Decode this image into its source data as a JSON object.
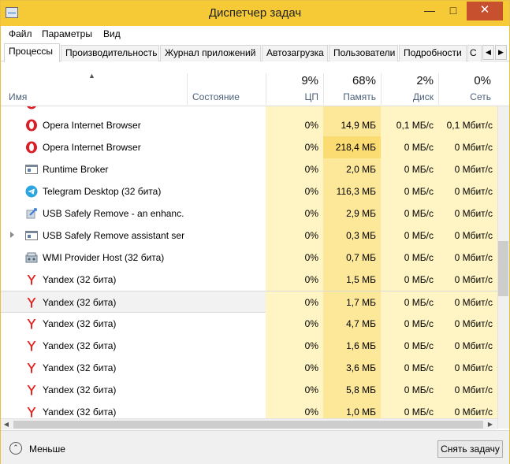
{
  "window": {
    "title": "Диспетчер задач"
  },
  "menu": [
    "Файл",
    "Параметры",
    "Вид"
  ],
  "tabs": [
    "Процессы",
    "Производительность",
    "Журнал приложений",
    "Автозагрузка",
    "Пользователи",
    "Подробности",
    "С"
  ],
  "columns": {
    "name": "Имя",
    "status": "Состояние",
    "cpu": {
      "pct": "9%",
      "label": "ЦП"
    },
    "memory": {
      "pct": "68%",
      "label": "Память"
    },
    "disk": {
      "pct": "2%",
      "label": "Диск"
    },
    "network": {
      "pct": "0%",
      "label": "Сеть"
    }
  },
  "rows": [
    {
      "icon": "opera-icon",
      "name": "Opera Internet Browser",
      "cpu": "0%",
      "mem": "14,9 МБ",
      "disk": "0,1 МБ/с",
      "net": "0,1 Мбит/с"
    },
    {
      "icon": "opera-icon",
      "name": "Opera Internet Browser",
      "cpu": "0%",
      "mem": "218,4 МБ",
      "disk": "0 МБ/с",
      "net": "0 Мбит/с"
    },
    {
      "icon": "runtime-broker-icon",
      "name": "Runtime Broker",
      "cpu": "0%",
      "mem": "2,0 МБ",
      "disk": "0 МБ/с",
      "net": "0 Мбит/с"
    },
    {
      "icon": "telegram-icon",
      "name": "Telegram Desktop (32 бита)",
      "cpu": "0%",
      "mem": "116,3 МБ",
      "disk": "0 МБ/с",
      "net": "0 Мбит/с"
    },
    {
      "icon": "usb-remove-icon",
      "name": "USB Safely Remove - an enhanc...",
      "cpu": "0%",
      "mem": "2,9 МБ",
      "disk": "0 МБ/с",
      "net": "0 Мбит/с"
    },
    {
      "icon": "app-window-icon",
      "name": "USB Safely Remove assistant ser...",
      "cpu": "0%",
      "mem": "0,3 МБ",
      "disk": "0 МБ/с",
      "net": "0 Мбит/с",
      "expandable": true
    },
    {
      "icon": "wmi-icon",
      "name": "WMI Provider Host (32 бита)",
      "cpu": "0%",
      "mem": "0,7 МБ",
      "disk": "0 МБ/с",
      "net": "0 Мбит/с"
    },
    {
      "icon": "yandex-icon",
      "name": "Yandex (32 бита)",
      "cpu": "0%",
      "mem": "1,5 МБ",
      "disk": "0 МБ/с",
      "net": "0 Мбит/с"
    },
    {
      "icon": "yandex-icon",
      "name": "Yandex (32 бита)",
      "cpu": "0%",
      "mem": "1,7 МБ",
      "disk": "0 МБ/с",
      "net": "0 Мбит/с",
      "selected": true
    },
    {
      "icon": "yandex-icon",
      "name": "Yandex (32 бита)",
      "cpu": "0%",
      "mem": "4,7 МБ",
      "disk": "0 МБ/с",
      "net": "0 Мбит/с"
    },
    {
      "icon": "yandex-icon",
      "name": "Yandex (32 бита)",
      "cpu": "0%",
      "mem": "1,6 МБ",
      "disk": "0 МБ/с",
      "net": "0 Мбит/с"
    },
    {
      "icon": "yandex-icon",
      "name": "Yandex (32 бита)",
      "cpu": "0%",
      "mem": "3,6 МБ",
      "disk": "0 МБ/с",
      "net": "0 Мбит/с"
    },
    {
      "icon": "yandex-icon",
      "name": "Yandex (32 бита)",
      "cpu": "0%",
      "mem": "5,8 МБ",
      "disk": "0 МБ/с",
      "net": "0 Мбит/с"
    },
    {
      "icon": "yandex-icon",
      "name": "Yandex (32 бита)",
      "cpu": "0%",
      "mem": "1,0 МБ",
      "disk": "0 МБ/с",
      "net": "0 Мбит/с"
    }
  ],
  "footer": {
    "less_label": "Меньше",
    "end_task_label": "Снять задачу"
  },
  "colors": {
    "titlebar": "#f6c937",
    "close": "#c7502f",
    "cpu_cell": "#fff4c4",
    "mem_cell": "#fde89a",
    "opera": "#d91e26",
    "telegram": "#2ca5e0",
    "yandex": "#e52521"
  }
}
